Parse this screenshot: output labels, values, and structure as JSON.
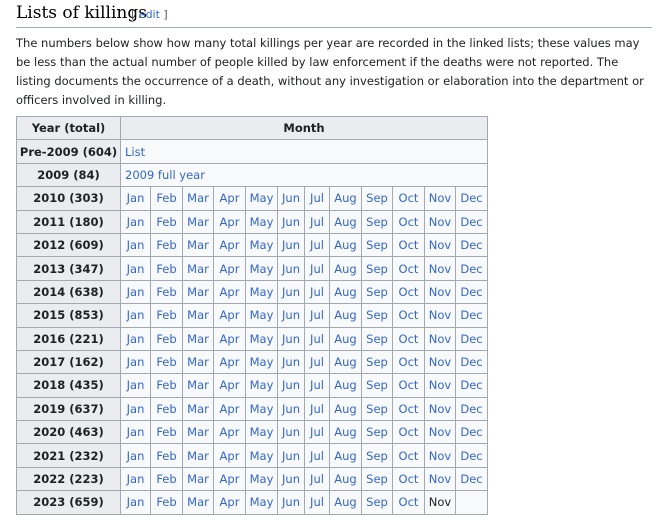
{
  "section": {
    "title": "Lists of killings",
    "edit_open": "[",
    "edit_label": "edit",
    "edit_close": "]"
  },
  "intro": "The numbers below show how many total killings per year are recorded in the linked lists; these values may be less than the actual number of people killed by law enforcement if the deaths were not reported. The listing documents the occurrence of a death, without any investigation or elaboration into the department or officers involved in killing.",
  "table": {
    "header_year": "Year (total)",
    "header_month": "Month",
    "months": [
      "Jan",
      "Feb",
      "Mar",
      "Apr",
      "May",
      "Jun",
      "Jul",
      "Aug",
      "Sep",
      "Oct",
      "Nov",
      "Dec"
    ],
    "rows": [
      {
        "year": "Pre-2009 (604)",
        "span_link": "List"
      },
      {
        "year": "2009 (84)",
        "span_link": "2009 full year"
      },
      {
        "year": "2010 (303)",
        "link_count": 12
      },
      {
        "year": "2011 (180)",
        "link_count": 12
      },
      {
        "year": "2012 (609)",
        "link_count": 12
      },
      {
        "year": "2013 (347)",
        "link_count": 12
      },
      {
        "year": "2014 (638)",
        "link_count": 12
      },
      {
        "year": "2015 (853)",
        "link_count": 12
      },
      {
        "year": "2016 (221)",
        "link_count": 12
      },
      {
        "year": "2017 (162)",
        "link_count": 12
      },
      {
        "year": "2018 (435)",
        "link_count": 12
      },
      {
        "year": "2019 (637)",
        "link_count": 12
      },
      {
        "year": "2020 (463)",
        "link_count": 12
      },
      {
        "year": "2021 (232)",
        "link_count": 12
      },
      {
        "year": "2022 (223)",
        "link_count": 12
      },
      {
        "year": "2023 (659)",
        "link_count": 10,
        "plain_after": 1
      }
    ]
  }
}
